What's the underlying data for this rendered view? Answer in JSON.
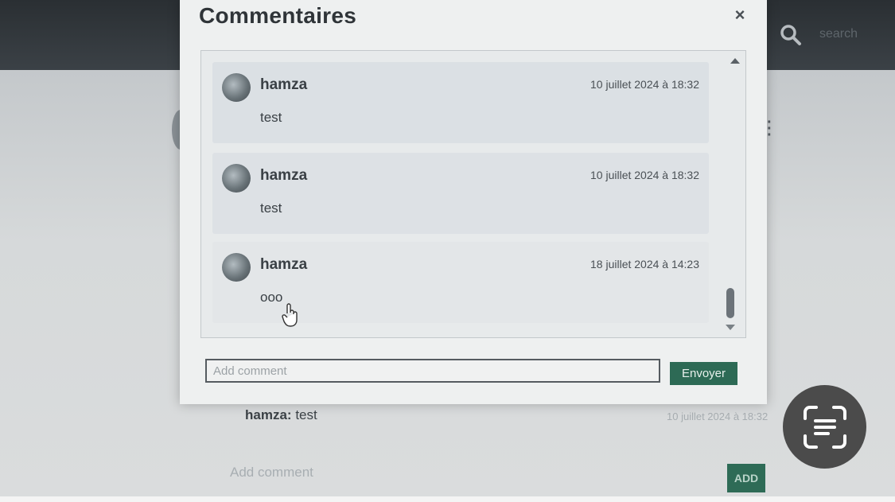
{
  "header": {
    "search_placeholder": "search"
  },
  "background": {
    "comment_author": "hamza:",
    "comment_text": "test",
    "comment_date": "10 juillet 2024 à 18:32",
    "add_comment_placeholder": "Add comment",
    "add_button_label": "ADD"
  },
  "modal": {
    "title": "Commentaires",
    "close_label": "×",
    "comments": [
      {
        "author": "hamza",
        "date": "10 juillet 2024 à 18:32",
        "text": "test"
      },
      {
        "author": "hamza",
        "date": "10 juillet 2024 à 18:32",
        "text": "test"
      },
      {
        "author": "hamza",
        "date": "18 juillet 2024 à 14:23",
        "text": "ooo"
      }
    ],
    "input_placeholder": "Add comment",
    "send_label": "Envoyer"
  },
  "colors": {
    "accent_green": "#2d6a55",
    "topbar": "#2a2f33",
    "fab": "#4b4b4b"
  },
  "icons": [
    "search-icon",
    "close-icon",
    "avatar",
    "kebab-menu-icon",
    "hand-cursor-icon",
    "text-scan-icon"
  ]
}
